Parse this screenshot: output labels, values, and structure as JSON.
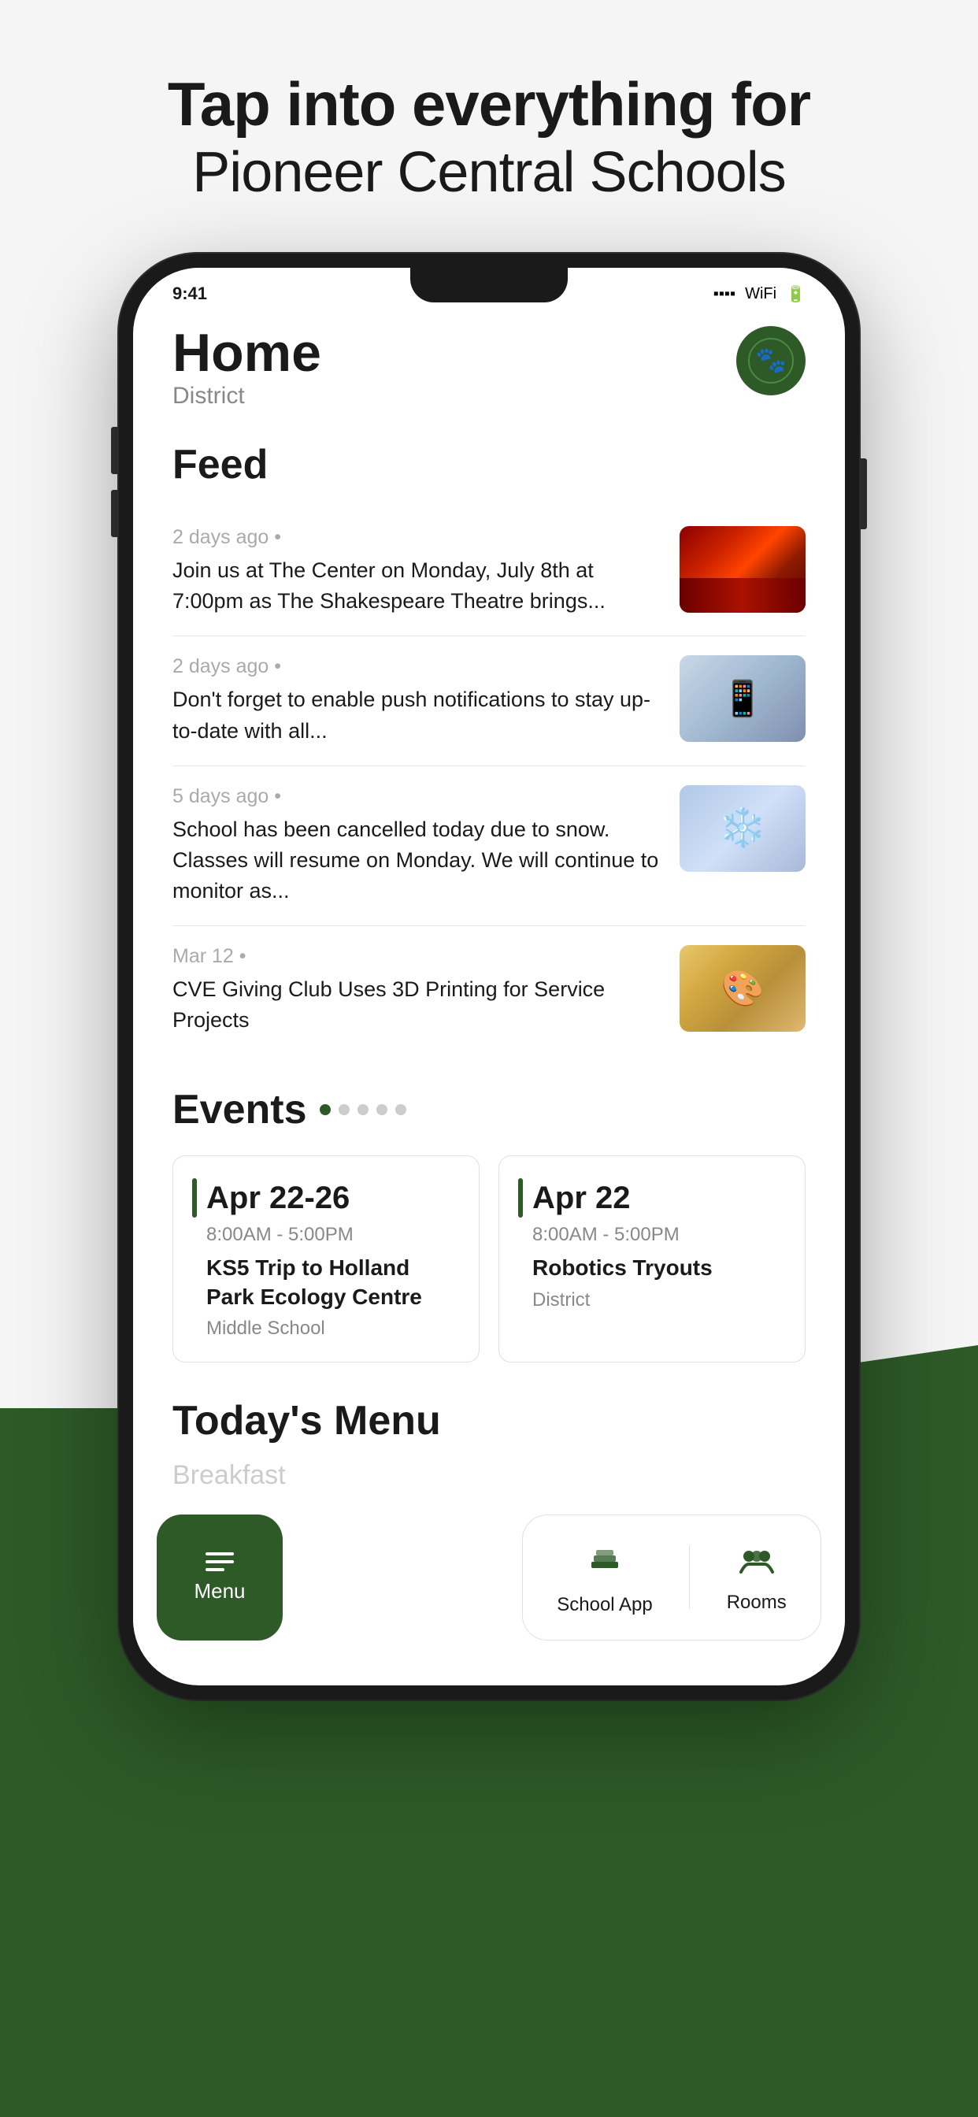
{
  "page": {
    "header": {
      "line1": "Tap into everything for",
      "line2": "Pioneer Central Schools"
    },
    "phone": {
      "home": {
        "title": "Home",
        "subtitle": "District"
      },
      "feed": {
        "section_title": "Feed",
        "items": [
          {
            "meta": "2 days ago",
            "body": "Join us at The Center on Monday, July 8th at 7:00pm as The Shakespeare Theatre brings...",
            "image_type": "theatre"
          },
          {
            "meta": "2 days ago",
            "body": "Don't forget to enable push notifications to stay up-to-date with all...",
            "image_type": "phone"
          },
          {
            "meta": "5 days ago",
            "body": "School has been cancelled today due to snow. Classes will resume on Monday. We will continue to monitor as...",
            "image_type": "snow"
          },
          {
            "meta": "Mar 12",
            "body": "CVE Giving Club Uses 3D Printing for Service Projects",
            "image_type": "kids"
          }
        ]
      },
      "events": {
        "section_title": "Events",
        "dots": [
          "active",
          "inactive",
          "inactive",
          "inactive",
          "inactive"
        ],
        "cards": [
          {
            "date": "Apr 22-26",
            "time": "8:00AM  -  5:00PM",
            "name": "KS5 Trip to Holland Park Ecology Centre",
            "location": "Middle School"
          },
          {
            "date": "Apr 22",
            "time": "8:00AM  -  5:00PM",
            "name": "Robotics Tryouts",
            "location": "District"
          }
        ]
      },
      "menu": {
        "section_title": "Today's Menu",
        "preview": "Breakfast"
      },
      "bottom_nav": {
        "menu_btn": "Menu",
        "school_app_btn": "School App",
        "rooms_btn": "Rooms"
      }
    }
  }
}
